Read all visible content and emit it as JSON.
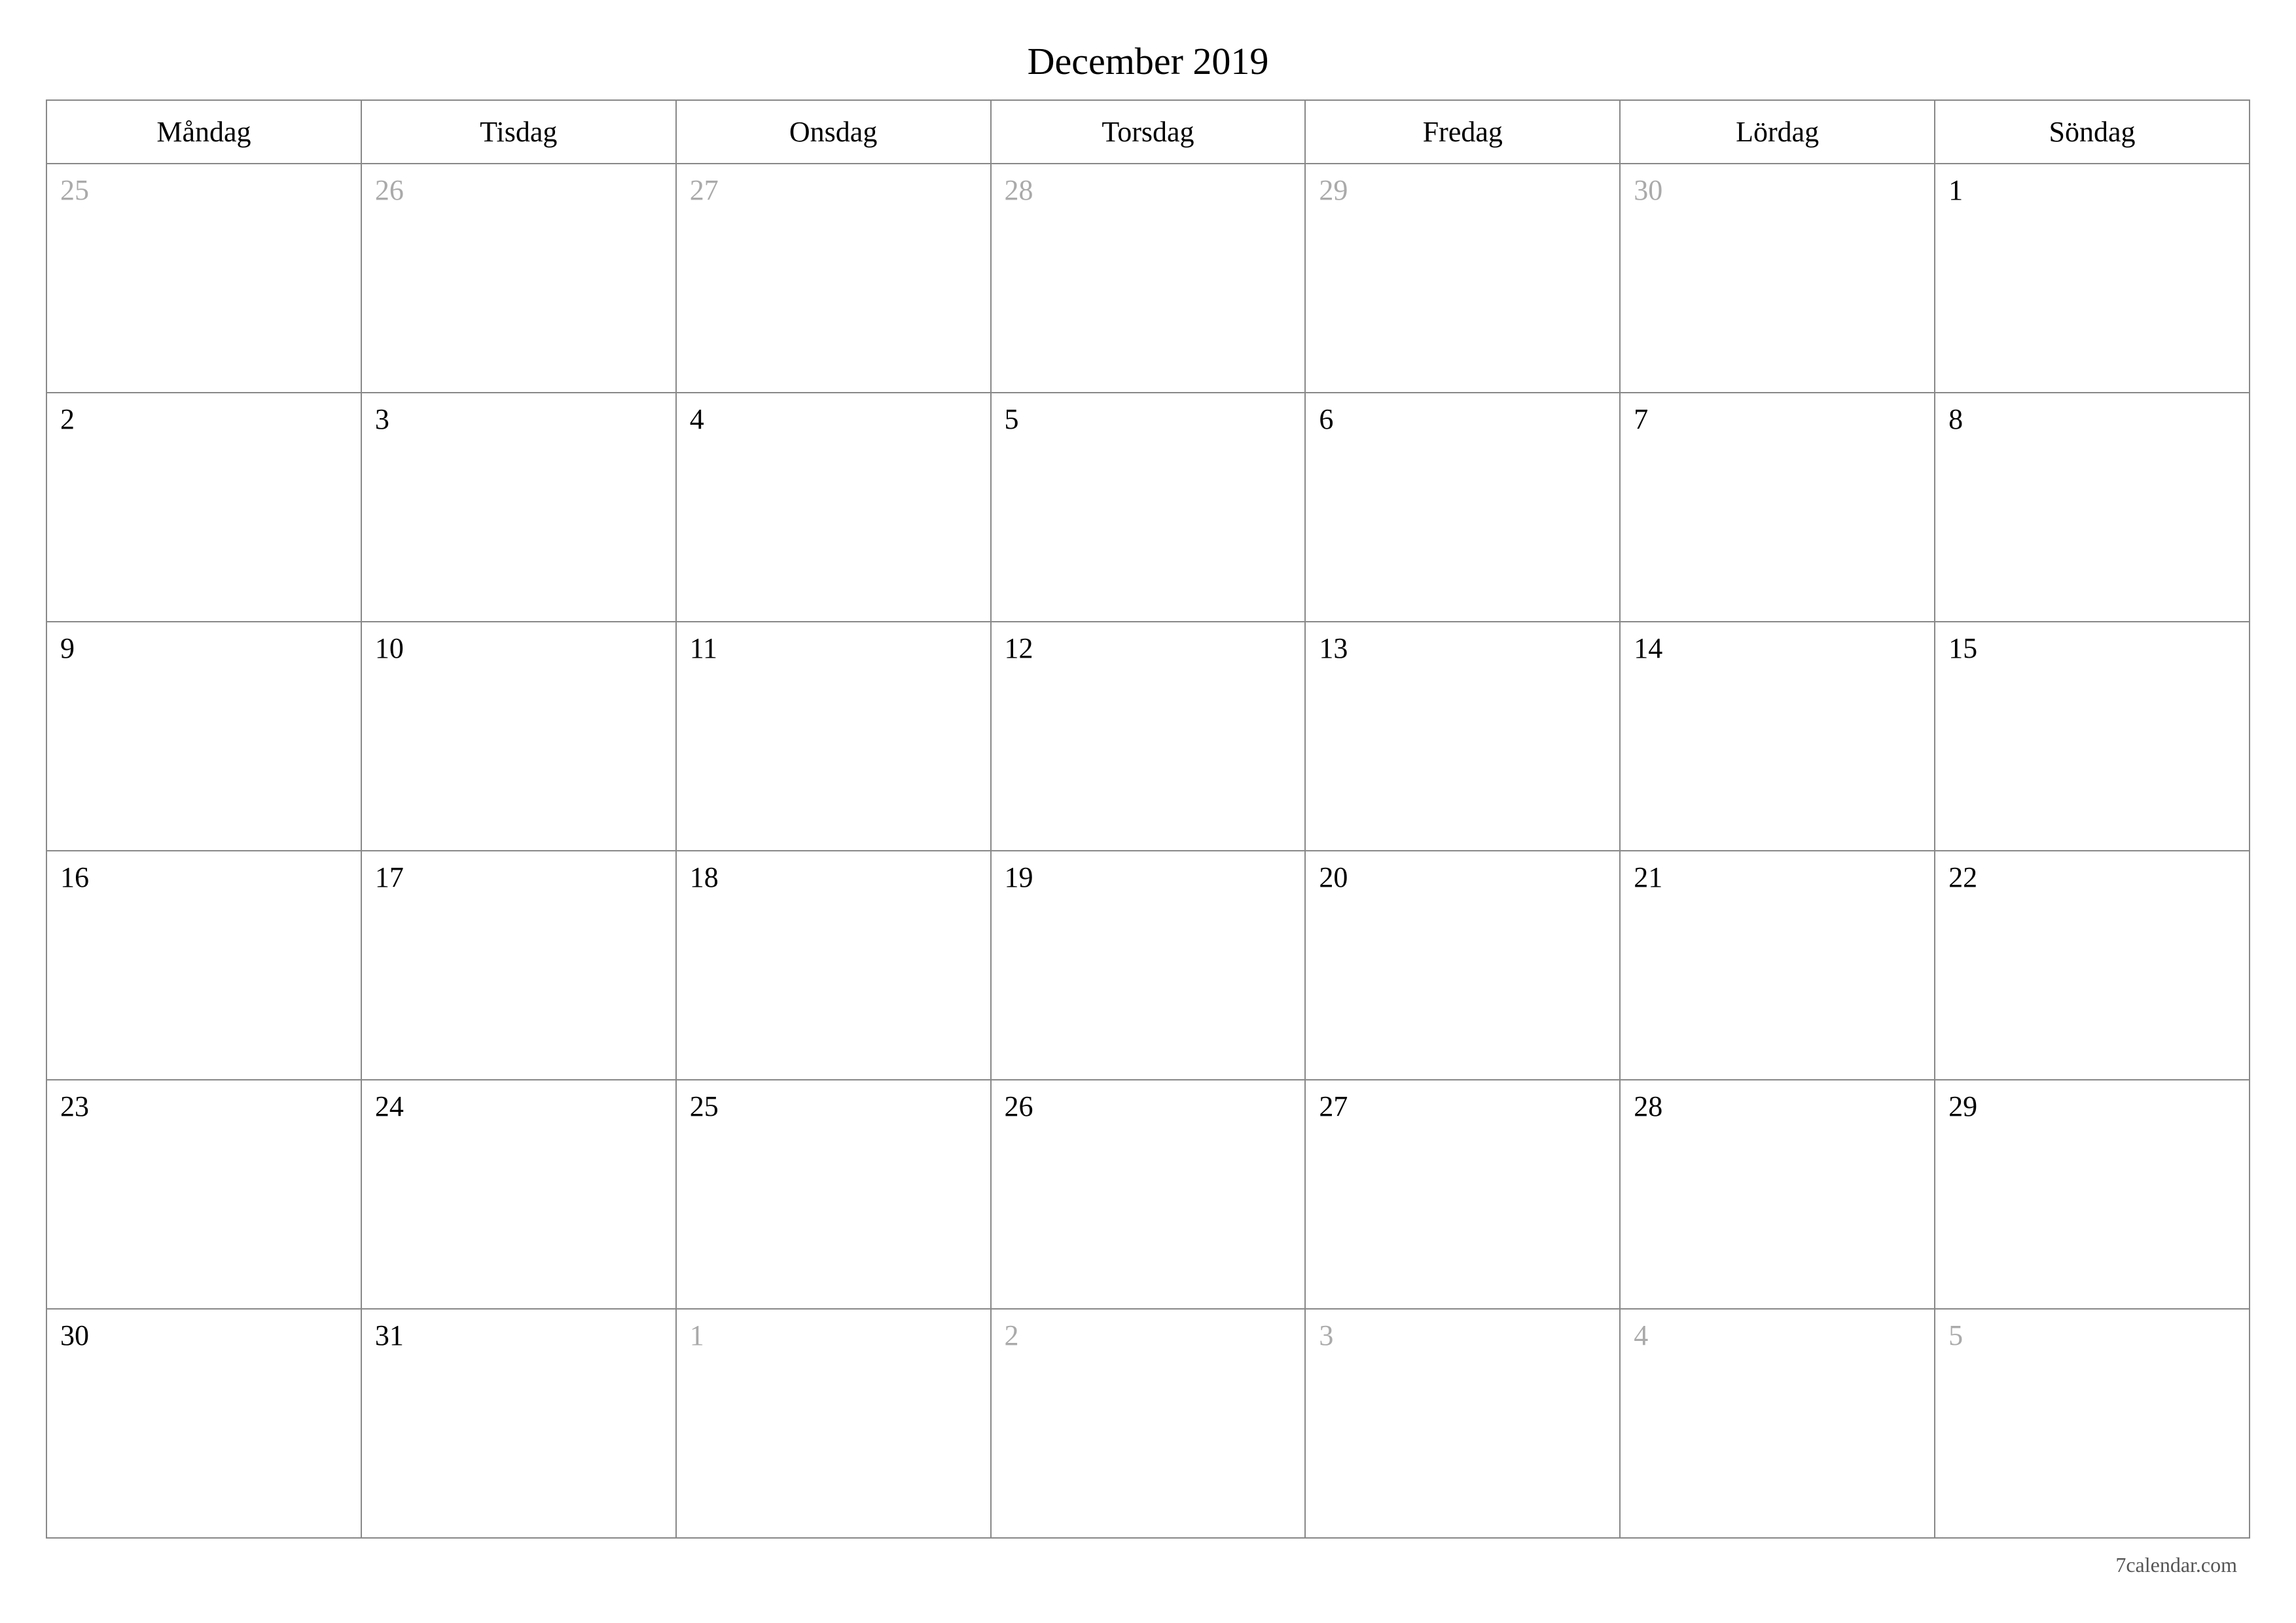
{
  "title": "December 2019",
  "weekdays": [
    "Måndag",
    "Tisdag",
    "Onsdag",
    "Torsdag",
    "Fredag",
    "Lördag",
    "Söndag"
  ],
  "weeks": [
    [
      {
        "day": "25",
        "muted": true
      },
      {
        "day": "26",
        "muted": true
      },
      {
        "day": "27",
        "muted": true
      },
      {
        "day": "28",
        "muted": true
      },
      {
        "day": "29",
        "muted": true
      },
      {
        "day": "30",
        "muted": true
      },
      {
        "day": "1",
        "muted": false
      }
    ],
    [
      {
        "day": "2",
        "muted": false
      },
      {
        "day": "3",
        "muted": false
      },
      {
        "day": "4",
        "muted": false
      },
      {
        "day": "5",
        "muted": false
      },
      {
        "day": "6",
        "muted": false
      },
      {
        "day": "7",
        "muted": false
      },
      {
        "day": "8",
        "muted": false
      }
    ],
    [
      {
        "day": "9",
        "muted": false
      },
      {
        "day": "10",
        "muted": false
      },
      {
        "day": "11",
        "muted": false
      },
      {
        "day": "12",
        "muted": false
      },
      {
        "day": "13",
        "muted": false
      },
      {
        "day": "14",
        "muted": false
      },
      {
        "day": "15",
        "muted": false
      }
    ],
    [
      {
        "day": "16",
        "muted": false
      },
      {
        "day": "17",
        "muted": false
      },
      {
        "day": "18",
        "muted": false
      },
      {
        "day": "19",
        "muted": false
      },
      {
        "day": "20",
        "muted": false
      },
      {
        "day": "21",
        "muted": false
      },
      {
        "day": "22",
        "muted": false
      }
    ],
    [
      {
        "day": "23",
        "muted": false
      },
      {
        "day": "24",
        "muted": false
      },
      {
        "day": "25",
        "muted": false
      },
      {
        "day": "26",
        "muted": false
      },
      {
        "day": "27",
        "muted": false
      },
      {
        "day": "28",
        "muted": false
      },
      {
        "day": "29",
        "muted": false
      }
    ],
    [
      {
        "day": "30",
        "muted": false
      },
      {
        "day": "31",
        "muted": false
      },
      {
        "day": "1",
        "muted": true
      },
      {
        "day": "2",
        "muted": true
      },
      {
        "day": "3",
        "muted": true
      },
      {
        "day": "4",
        "muted": true
      },
      {
        "day": "5",
        "muted": true
      }
    ]
  ],
  "footer": "7calendar.com"
}
